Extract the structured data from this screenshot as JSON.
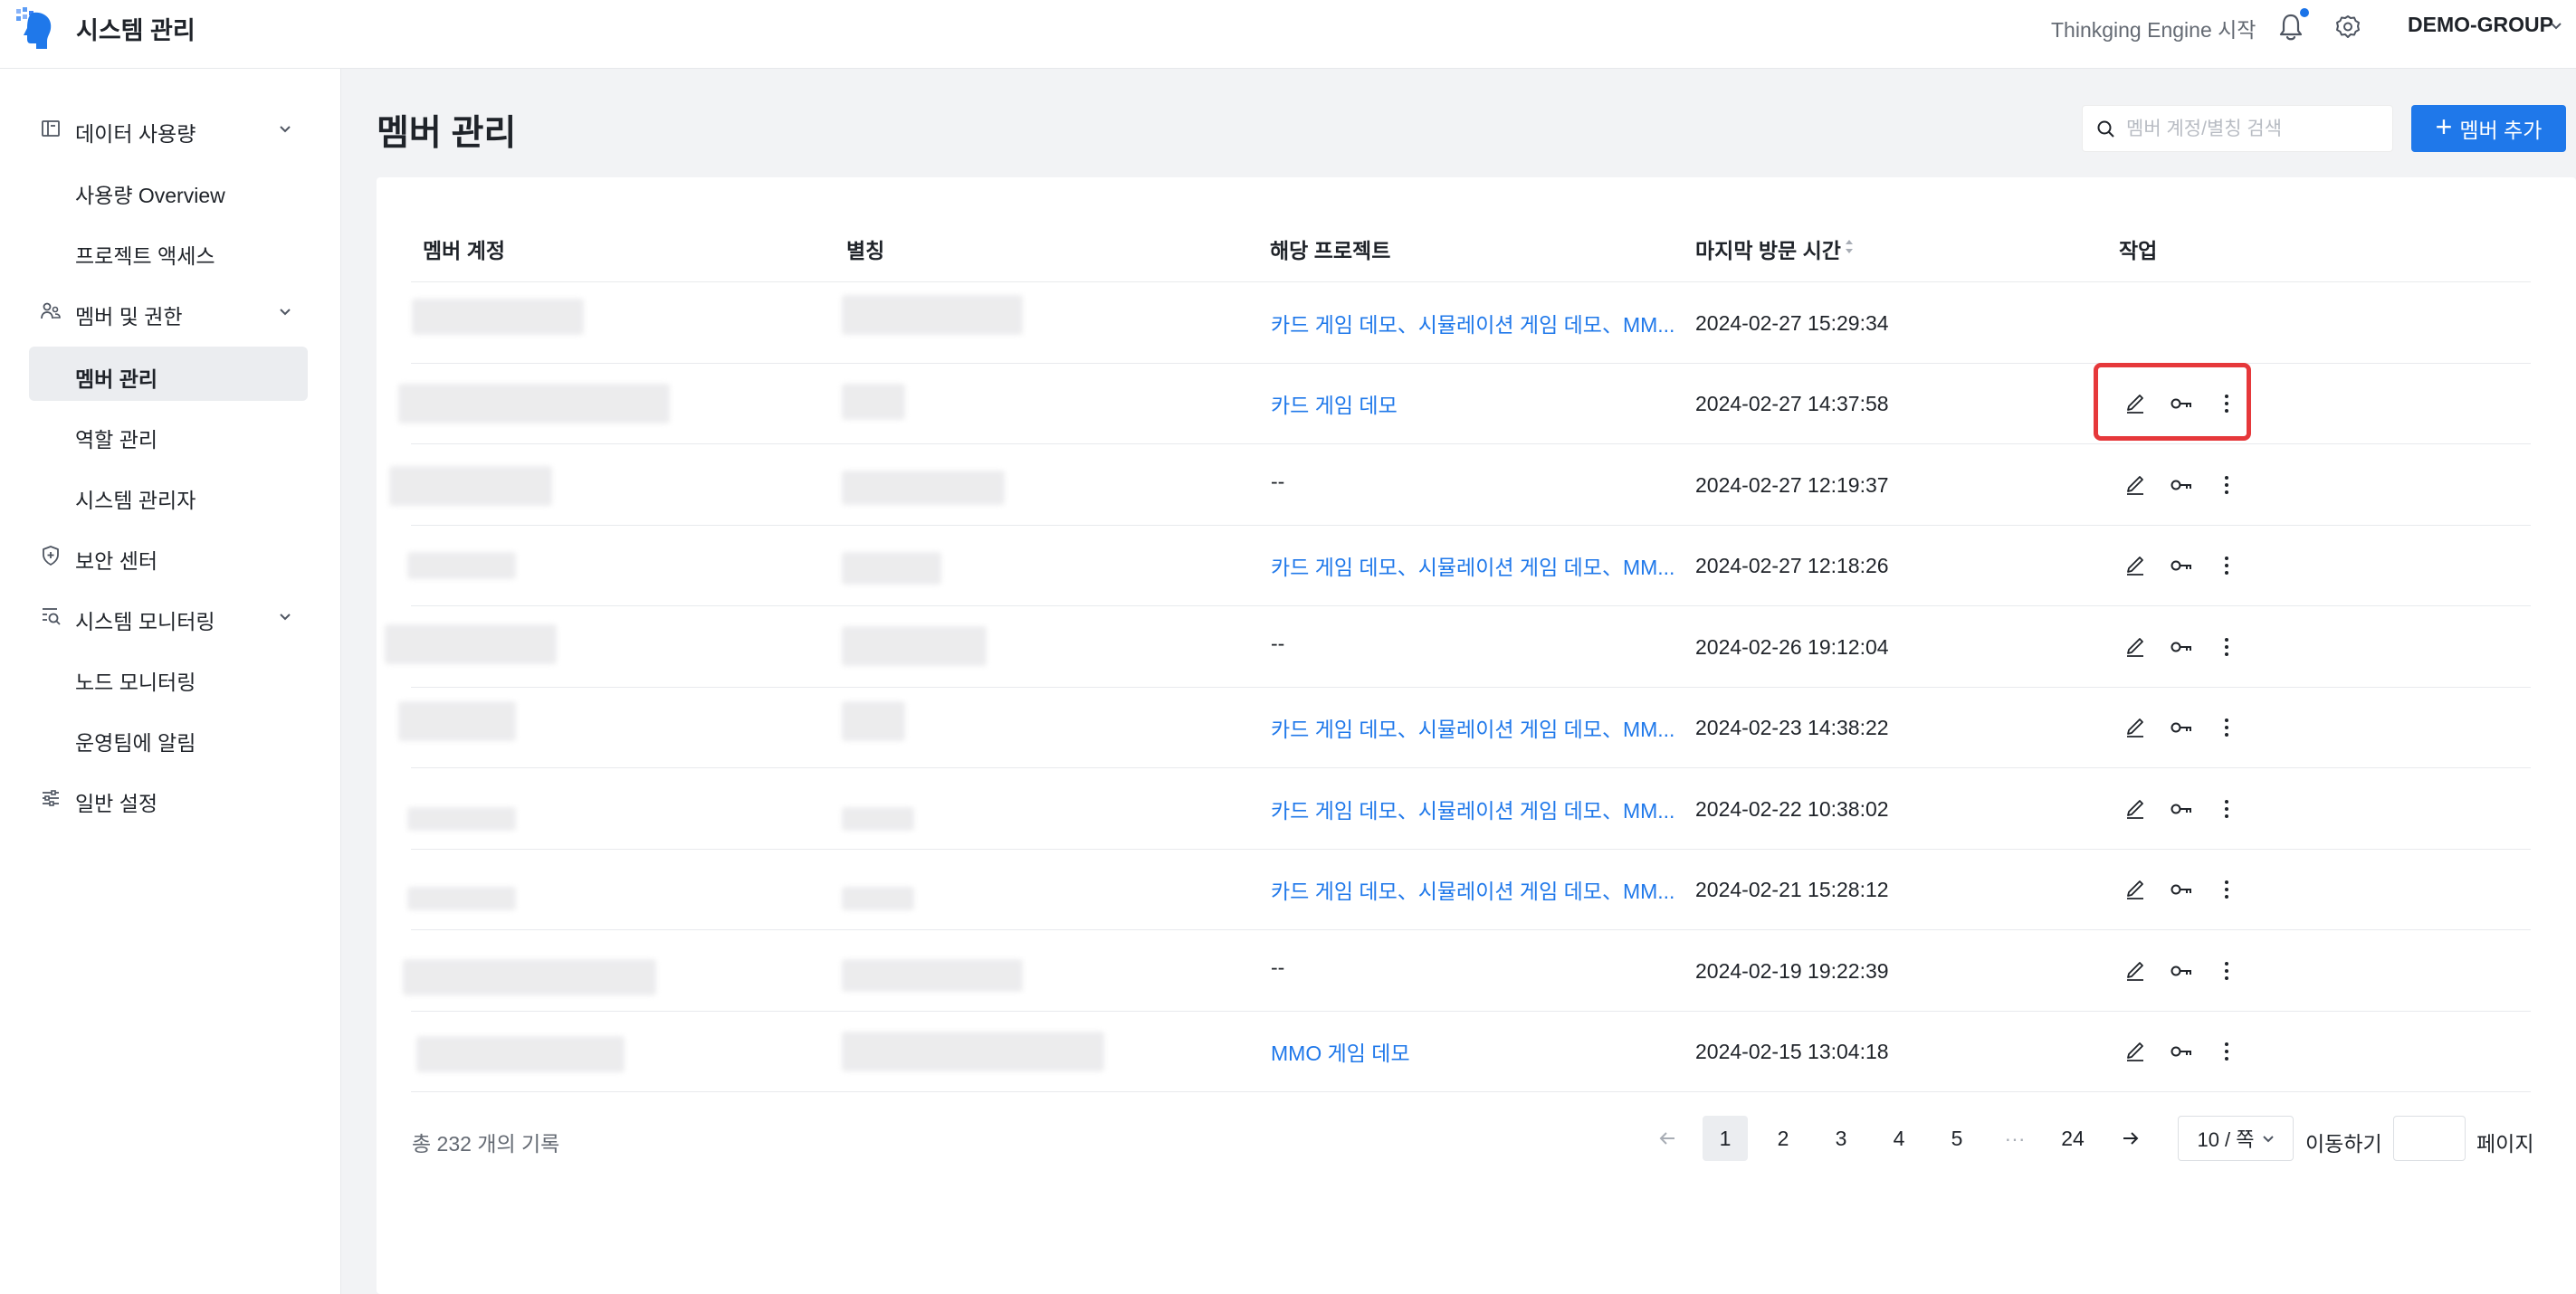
{
  "header": {
    "app_title": "시스템 관리",
    "engine_link": "Thinkging Engine 시작",
    "org": "DEMO-GROUP",
    "accent": "#1f78ea"
  },
  "sidebar": {
    "groups": [
      {
        "label": "데이터 사용량",
        "icon": "book-icon",
        "items": [
          "사용량 Overview",
          "프로젝트 액세스"
        ]
      },
      {
        "label": "멤버 및 권한",
        "icon": "users-icon",
        "items": [
          "멤버 관리",
          "역할 관리",
          "시스템 관리자"
        ]
      },
      {
        "label": "보안 센터",
        "icon": "shield-icon",
        "items": []
      },
      {
        "label": "시스템 모니터링",
        "icon": "monitor-search-icon",
        "items": [
          "노드 모니터링",
          "운영팀에 알림"
        ]
      },
      {
        "label": "일반 설정",
        "icon": "sliders-icon",
        "items": []
      }
    ],
    "active_item": "멤버 관리"
  },
  "main": {
    "title": "멤버 관리",
    "search_placeholder": "멤버 계정/별칭 검색",
    "add_button": "멤버 추가",
    "columns": [
      "멤버 계정",
      "별칭",
      "해당 프로젝트",
      "마지막 방문 시간",
      "작업"
    ],
    "rows": [
      {
        "project": "카드 게임 데모、시뮬레이션 게임 데모、MM...",
        "time": "2024-02-27 15:29:34",
        "actions": false
      },
      {
        "project": "카드 게임 데모",
        "time": "2024-02-27 14:37:58",
        "actions": true
      },
      {
        "project": "--",
        "time": "2024-02-27 12:19:37",
        "actions": true
      },
      {
        "project": "카드 게임 데모、시뮬레이션 게임 데모、MM...",
        "time": "2024-02-27 12:18:26",
        "actions": true
      },
      {
        "project": "--",
        "time": "2024-02-26 19:12:04",
        "actions": true
      },
      {
        "project": "카드 게임 데모、시뮬레이션 게임 데모、MM...",
        "time": "2024-02-23 14:38:22",
        "actions": true
      },
      {
        "project": "카드 게임 데모、시뮬레이션 게임 데모、MM...",
        "time": "2024-02-22 10:38:02",
        "actions": true
      },
      {
        "project": "카드 게임 데모、시뮬레이션 게임 데모、MM...",
        "time": "2024-02-21 15:28:12",
        "actions": true
      },
      {
        "project": "--",
        "time": "2024-02-19 19:22:39",
        "actions": true
      },
      {
        "project": "MMO 게임 데모",
        "time": "2024-02-15 13:04:18",
        "actions": true
      }
    ]
  },
  "pagination": {
    "total": "총 232 개의 기록",
    "pages": [
      "1",
      "2",
      "3",
      "4",
      "5",
      "···",
      "24"
    ],
    "current": "1",
    "page_size": "10 / 쪽",
    "goto_label": "이동하기",
    "page_label": "페이지"
  }
}
